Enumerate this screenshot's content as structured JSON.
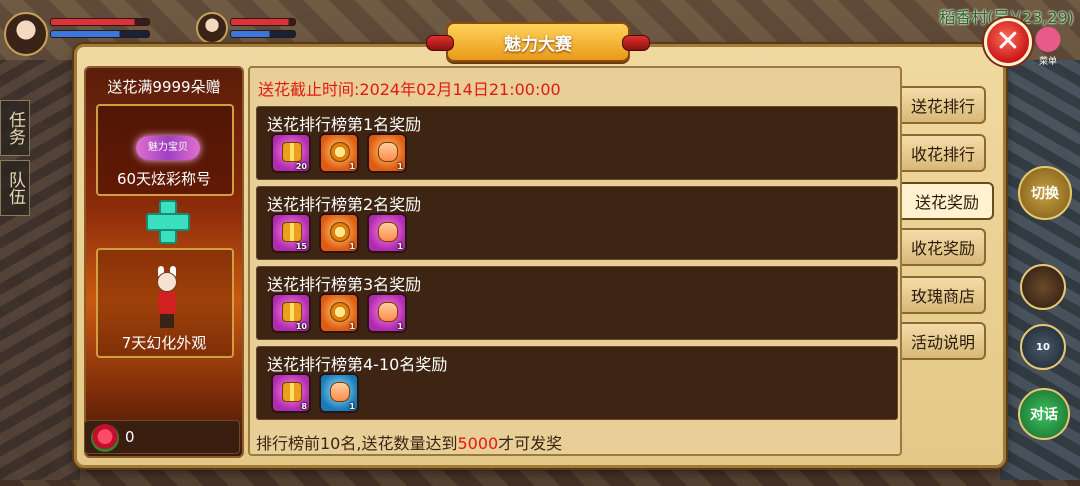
{
  "hud": {
    "location": "稻香村(吴)(23,29)",
    "menu_label": "菜单",
    "side_tab_task": "任务",
    "side_tab_team": "队伍"
  },
  "side_buttons": {
    "switch_label": "切换",
    "item2_count": "10",
    "chat_label": "对话"
  },
  "dialog": {
    "title": "魅力大赛",
    "close_glyph": "✕",
    "deadline": "送花截止时间:2024年02月14日21:00:00"
  },
  "promo": {
    "heading": "送花满9999朵赠",
    "title_badge": "魅力宝贝",
    "reward1_caption": "60天炫彩称号",
    "reward2_caption": "7天幻化外观",
    "rose_count": "0"
  },
  "rewards": [
    {
      "title": "送花排行榜第1名奖励",
      "items": [
        {
          "icon": "gift-box-icon",
          "color": "purple",
          "qty": "20"
        },
        {
          "icon": "medal-icon",
          "color": "orange",
          "qty": "1"
        },
        {
          "icon": "scroll-icon",
          "color": "orange",
          "qty": "1"
        }
      ]
    },
    {
      "title": "送花排行榜第2名奖励",
      "items": [
        {
          "icon": "gift-box-icon",
          "color": "purple",
          "qty": "15"
        },
        {
          "icon": "medal-icon",
          "color": "orange",
          "qty": "1"
        },
        {
          "icon": "scroll-icon",
          "color": "purple",
          "qty": "1"
        }
      ]
    },
    {
      "title": "送花排行榜第3名奖励",
      "items": [
        {
          "icon": "gift-box-icon",
          "color": "purple",
          "qty": "10"
        },
        {
          "icon": "medal-icon",
          "color": "orange",
          "qty": "1"
        },
        {
          "icon": "scroll-icon",
          "color": "purple",
          "qty": "1"
        }
      ]
    },
    {
      "title": "送花排行榜第4-10名奖励",
      "items": [
        {
          "icon": "gift-box-icon",
          "color": "purple",
          "qty": "8"
        },
        {
          "icon": "scroll-icon",
          "color": "blue",
          "qty": "1"
        }
      ]
    }
  ],
  "footer": {
    "prefix": "排行榜前10名,送花数量达到",
    "highlight": "5000",
    "suffix": "才可发奖"
  },
  "tabs": [
    {
      "label": "送花排行",
      "active": false
    },
    {
      "label": "收花排行",
      "active": false
    },
    {
      "label": "送花奖励",
      "active": true
    },
    {
      "label": "收花奖励",
      "active": false
    },
    {
      "label": "玫瑰商店",
      "active": false
    },
    {
      "label": "活动说明",
      "active": false
    }
  ],
  "colors": {
    "accent_red": "#e01a10",
    "panel_gold": "#f0d9a0",
    "card_brown": "#3e2412"
  }
}
